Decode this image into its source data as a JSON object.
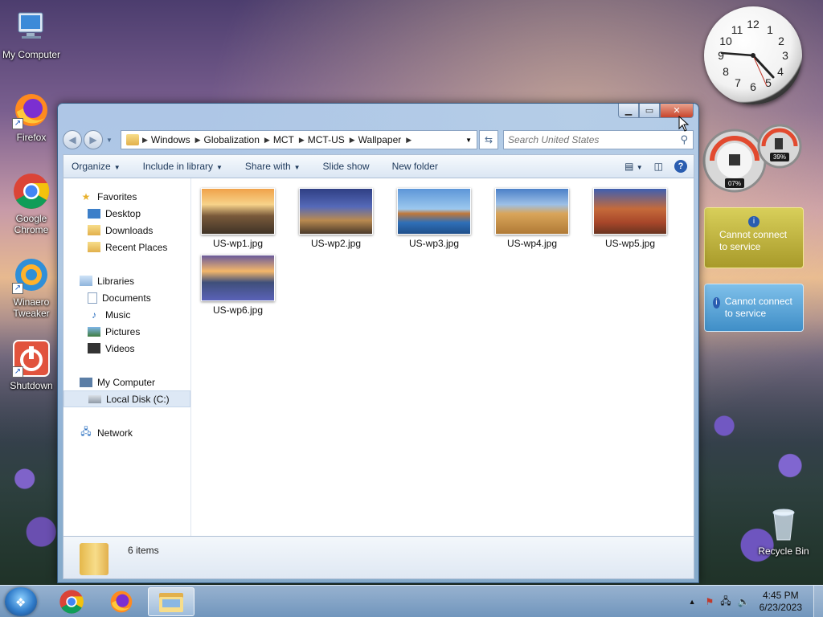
{
  "desktop": {
    "icons": [
      {
        "label": "My Computer"
      },
      {
        "label": "Firefox"
      },
      {
        "label": "Google Chrome"
      },
      {
        "label": "Winaero Tweaker"
      },
      {
        "label": "Shutdown"
      },
      {
        "label": "Recycle Bin"
      }
    ]
  },
  "gadgets": {
    "clock": {
      "numbers": [
        "12",
        "1",
        "2",
        "3",
        "4",
        "5",
        "6",
        "7",
        "8",
        "9",
        "10",
        "11"
      ]
    },
    "meter": {
      "cpu": "07%",
      "memory": "39%"
    },
    "weather_msg": "Cannot connect to service",
    "currency_msg": "Cannot connect to service"
  },
  "explorer": {
    "breadcrumb": [
      "Windows",
      "Globalization",
      "MCT",
      "MCT-US",
      "Wallpaper"
    ],
    "search_placeholder": "Search United States",
    "toolbar": {
      "organize": "Organize",
      "include": "Include in library",
      "share": "Share with",
      "slideshow": "Slide show",
      "new_folder": "New folder"
    },
    "nav": {
      "favorites": "Favorites",
      "desktop": "Desktop",
      "downloads": "Downloads",
      "recent": "Recent Places",
      "libraries": "Libraries",
      "documents": "Documents",
      "music": "Music",
      "pictures": "Pictures",
      "videos": "Videos",
      "computer": "My Computer",
      "local_disk": "Local Disk (C:)",
      "network": "Network"
    },
    "files": [
      {
        "name": "US-wp1.jpg"
      },
      {
        "name": "US-wp2.jpg"
      },
      {
        "name": "US-wp3.jpg"
      },
      {
        "name": "US-wp4.jpg"
      },
      {
        "name": "US-wp5.jpg"
      },
      {
        "name": "US-wp6.jpg"
      }
    ],
    "status": {
      "count": "6 items"
    }
  },
  "taskbar": {
    "time": "4:45 PM",
    "date": "6/23/2023"
  }
}
